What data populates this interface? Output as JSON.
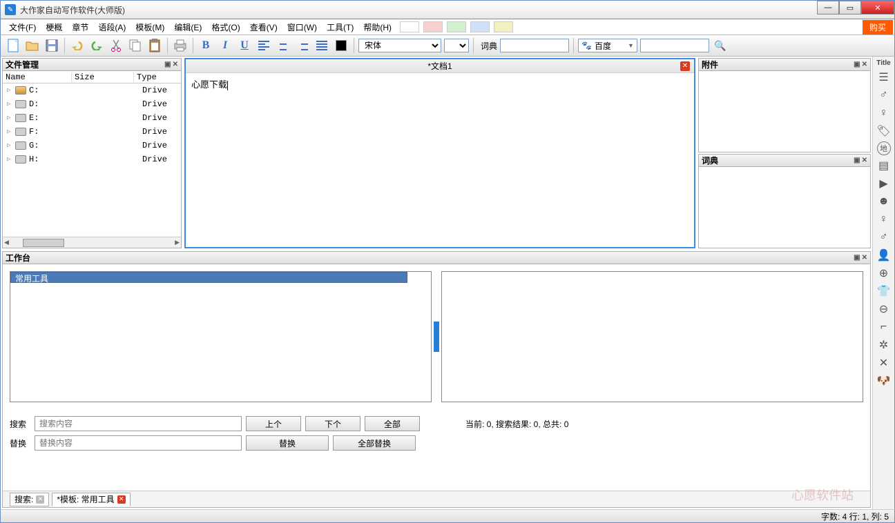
{
  "app": {
    "title": "大作家自动写作软件(大师版)"
  },
  "menu": {
    "items": [
      "文件(F)",
      "梗概",
      "章节",
      "语段(A)",
      "模板(M)",
      "编辑(E)",
      "格式(O)",
      "查看(V)",
      "窗口(W)",
      "工具(T)",
      "帮助(H)"
    ],
    "buy": "购买",
    "swatches": [
      "#ffffff",
      "#f8d0d0",
      "#d0f0d0",
      "#d0e0f8",
      "#f0f0c0"
    ]
  },
  "toolbar": {
    "font": "宋体",
    "dict_label": "词典",
    "search_engine": "百度",
    "search_icon": "🔍"
  },
  "filemgr": {
    "title": "文件管理",
    "cols": [
      "Name",
      "Size",
      "Type"
    ],
    "drives": [
      {
        "name": "C:",
        "type": "Drive"
      },
      {
        "name": "D:",
        "type": "Drive"
      },
      {
        "name": "E:",
        "type": "Drive"
      },
      {
        "name": "F:",
        "type": "Drive"
      },
      {
        "name": "G:",
        "type": "Drive"
      },
      {
        "name": "H:",
        "type": "Drive"
      }
    ]
  },
  "editor": {
    "doc_title": "*文档1",
    "content": "心愿下载"
  },
  "right": {
    "attach_title": "附件",
    "dict_title": "词典",
    "sidebar_label": "Title"
  },
  "workbench": {
    "title": "工作台",
    "tool_tab": "常用工具",
    "search_label": "搜索",
    "search_placeholder": "搜索内容",
    "replace_label": "替换",
    "replace_placeholder": "替换内容",
    "btn_prev": "上个",
    "btn_next": "下个",
    "btn_all": "全部",
    "btn_replace": "替换",
    "btn_replace_all": "全部替换",
    "result_status": "当前: 0,  搜索结果: 0, 总共: 0",
    "tabs": {
      "search": "搜索:",
      "template": "*模板: 常用工具"
    }
  },
  "statusbar": {
    "text": "字数: 4 行: 1, 列: 5"
  },
  "watermark": "心愿软件站"
}
